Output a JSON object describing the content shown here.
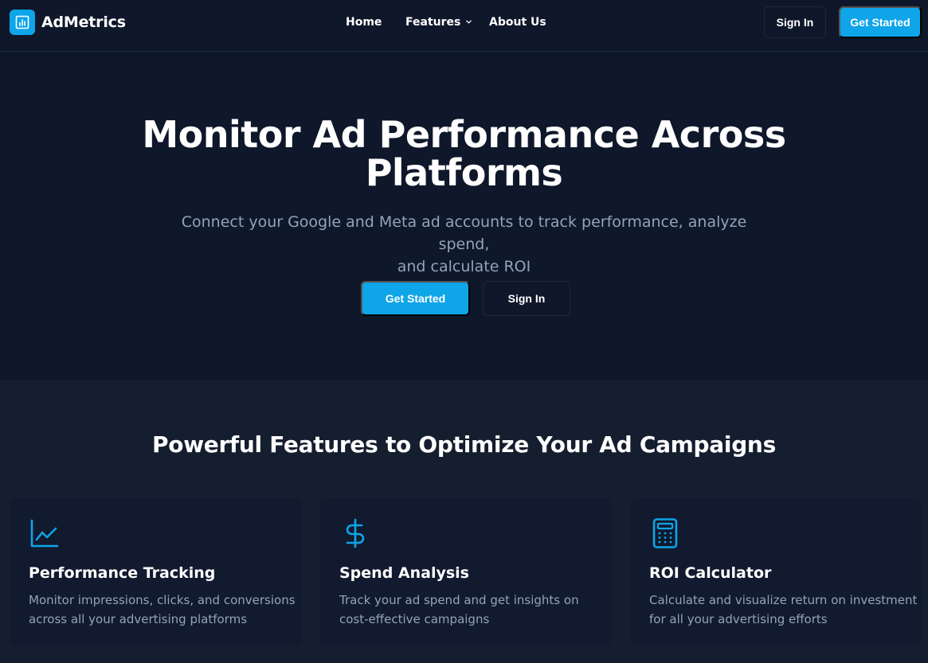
{
  "brand": {
    "name": "AdMetrics",
    "icon": "bar-chart-icon"
  },
  "nav": {
    "home": "Home",
    "features": "Features",
    "about": "About Us",
    "sign_in": "Sign In",
    "get_started": "Get Started"
  },
  "hero": {
    "title_line1": "Monitor Ad Performance Across",
    "title_line2": "Platforms",
    "subtitle_line1": "Connect your Google and Meta ad accounts to track performance, analyze spend,",
    "subtitle_line2": "and calculate ROI",
    "cta_primary": "Get Started",
    "cta_secondary": "Sign In"
  },
  "features": {
    "title": "Powerful Features to Optimize Your Ad Campaigns",
    "cards": [
      {
        "icon": "line-chart-icon",
        "title": "Performance Tracking",
        "desc_line1": "Monitor impressions, clicks, and conversions",
        "desc_line2": "across all your advertising platforms"
      },
      {
        "icon": "dollar-sign-icon",
        "title": "Spend Analysis",
        "desc_line1": "Track your ad spend and get insights on",
        "desc_line2": "cost-effective campaigns"
      },
      {
        "icon": "calculator-icon",
        "title": "ROI Calculator",
        "desc_line1": "Calculate and visualize return on investment",
        "desc_line2": "for all your advertising efforts"
      }
    ]
  },
  "colors": {
    "accent": "#0ea5e9",
    "background": "#0f172a",
    "section": "#151e2f",
    "card": "#111a2e",
    "muted_text": "#94a3b8"
  }
}
